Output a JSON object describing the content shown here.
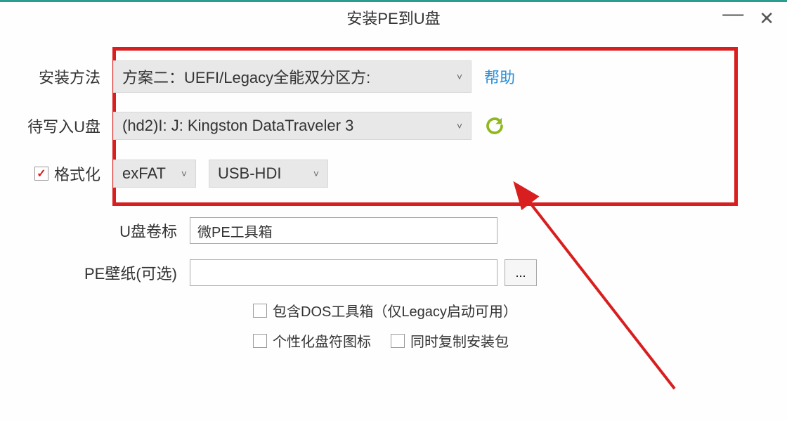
{
  "window": {
    "title": "安装PE到U盘"
  },
  "rows": {
    "install_method": {
      "label": "安装方法",
      "selected": "方案二：UEFI/Legacy全能双分区方:",
      "help": "帮助"
    },
    "target_usb": {
      "label": "待写入U盘",
      "selected": "(hd2)I: J: Kingston DataTraveler 3"
    },
    "format": {
      "label": "格式化",
      "filesystem": "exFAT",
      "boot_mode": "USB-HDI"
    },
    "volume_label": {
      "label": "U盘卷标",
      "value": "微PE工具箱"
    },
    "wallpaper": {
      "label": "PE壁纸(可选)",
      "value": "",
      "browse": "..."
    },
    "opts": {
      "dos_toolbox": "包含DOS工具箱（仅Legacy启动可用）",
      "custom_icon": "个性化盘符图标",
      "copy_installer": "同时复制安装包"
    }
  }
}
